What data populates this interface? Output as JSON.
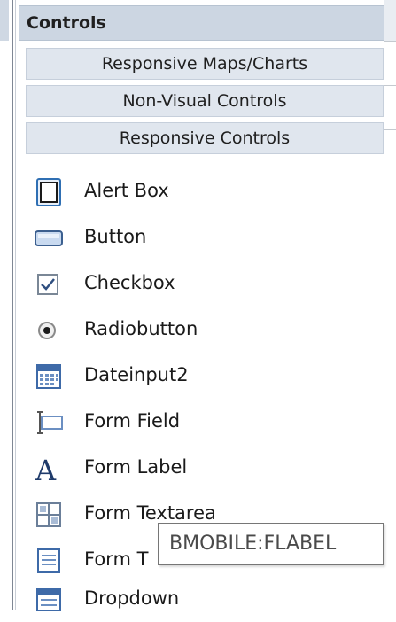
{
  "panel": {
    "title": "Controls",
    "categories": [
      "Responsive Maps/Charts",
      "Non-Visual Controls",
      "Responsive Controls"
    ],
    "items": [
      {
        "label": "Alert Box",
        "icon": "alert-box-icon"
      },
      {
        "label": "Button",
        "icon": "button-icon"
      },
      {
        "label": "Checkbox",
        "icon": "checkbox-icon"
      },
      {
        "label": "Radiobutton",
        "icon": "radiobutton-icon"
      },
      {
        "label": "Dateinput2",
        "icon": "calendar-icon"
      },
      {
        "label": "Form Field",
        "icon": "text-field-icon"
      },
      {
        "label": "Form Label",
        "icon": "letter-a-icon"
      },
      {
        "label": "Form Textarea",
        "icon": "textarea-icon"
      },
      {
        "label": "Form T",
        "icon": "document-icon"
      },
      {
        "label": "Dropdown",
        "icon": "dropdown-icon"
      }
    ]
  },
  "tooltip": {
    "text": "BMOBILE:FLABEL"
  },
  "colors": {
    "header_bg": "#ccd6e2",
    "tab_bg": "#e0e6ee",
    "icon_blue": "#2f6fb3"
  }
}
